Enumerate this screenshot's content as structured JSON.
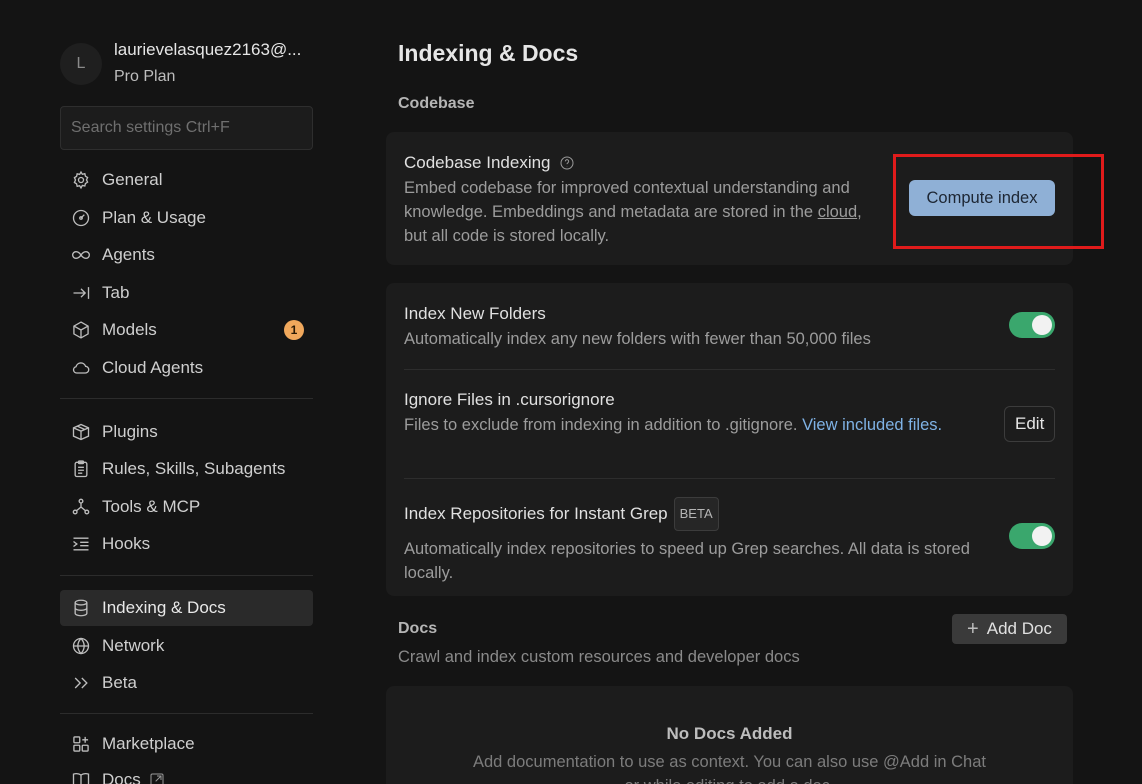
{
  "profile": {
    "avatar_letter": "L",
    "email": "laurievelasquez2163@...",
    "plan": "Pro Plan"
  },
  "search": {
    "placeholder": "Search settings Ctrl+F"
  },
  "sidebar": {
    "items": [
      {
        "label": "General",
        "icon": "gear-icon"
      },
      {
        "label": "Plan & Usage",
        "icon": "gauge-icon"
      },
      {
        "label": "Agents",
        "icon": "infinity-icon"
      },
      {
        "label": "Tab",
        "icon": "tab-arrow-icon"
      },
      {
        "label": "Models",
        "icon": "cube-icon",
        "badge": "1"
      },
      {
        "label": "Cloud Agents",
        "icon": "cloud-icon"
      },
      {
        "label": "Plugins",
        "icon": "package-icon"
      },
      {
        "label": "Rules, Skills, Subagents",
        "icon": "clipboard-icon"
      },
      {
        "label": "Tools & MCP",
        "icon": "nodes-icon"
      },
      {
        "label": "Hooks",
        "icon": "list-indent-icon"
      },
      {
        "label": "Indexing & Docs",
        "icon": "database-icon",
        "active": true
      },
      {
        "label": "Network",
        "icon": "globe-icon"
      },
      {
        "label": "Beta",
        "icon": "double-chevron-icon"
      },
      {
        "label": "Marketplace",
        "icon": "grid-plus-icon"
      },
      {
        "label": "Docs",
        "icon": "book-icon"
      }
    ]
  },
  "main": {
    "title": "Indexing & Docs",
    "codebase_label": "Codebase",
    "codebase_indexing": {
      "title": "Codebase Indexing",
      "desc_part1": "Embed codebase for improved contextual understanding and knowledge. Embeddings and metadata are stored in the ",
      "desc_link": "cloud",
      "desc_part2": ", but all code is stored locally.",
      "button": "Compute index"
    },
    "index_new_folders": {
      "title": "Index New Folders",
      "desc": "Automatically index any new folders with fewer than 50,000 files"
    },
    "ignore_files": {
      "title": "Ignore Files in .cursorignore",
      "desc": "Files to exclude from indexing in addition to .gitignore. ",
      "link": "View included files.",
      "button": "Edit"
    },
    "instant_grep": {
      "title": "Index Repositories for Instant Grep",
      "badge": "BETA",
      "desc": "Automatically index repositories to speed up Grep searches. All data is stored locally."
    },
    "docs": {
      "label": "Docs",
      "desc": "Crawl and index custom resources and developer docs",
      "add_button": "Add Doc",
      "empty_title": "No Docs Added",
      "empty_desc": "Add documentation to use as context. You can also use @Add in Chat or while editing to add a doc."
    }
  },
  "colors": {
    "accent_button": "#8fb0d6",
    "toggle_on": "#3aa76d",
    "badge": "#f0a85c",
    "highlight": "#e01b1b",
    "link": "#7fb2e5"
  }
}
